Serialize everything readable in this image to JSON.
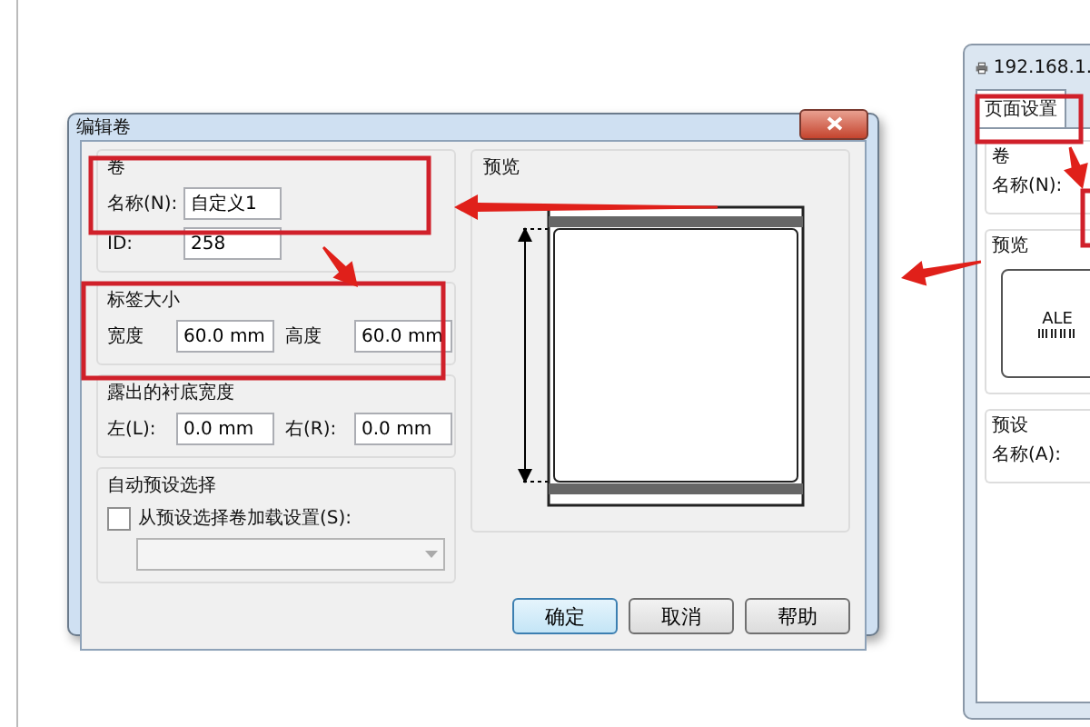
{
  "dialog": {
    "title": "编辑卷",
    "groups": [
      {
        "title": "卷",
        "items": [
          {
            "kind": "fields",
            "fields": [
              {
                "label": "名称(N):",
                "value": "自定义1"
              }
            ]
          },
          {
            "kind": "fields",
            "fields": [
              {
                "label": "ID:",
                "value": "258"
              }
            ]
          }
        ]
      },
      {
        "title": "标签大小",
        "items": [
          {
            "kind": "fields",
            "fields": [
              {
                "label": "宽度",
                "value": "60.0 mm"
              },
              {
                "label": "高度",
                "value": "60.0 mm"
              }
            ]
          }
        ]
      },
      {
        "title": "露出的衬底宽度",
        "items": [
          {
            "kind": "fields",
            "fields": [
              {
                "label": "左(L):",
                "value": "0.0 mm"
              },
              {
                "label": "右(R):",
                "value": "0.0 mm"
              }
            ]
          }
        ]
      },
      {
        "title": "自动预设选择",
        "items": [
          {
            "kind": "checkbox",
            "label": "从预设选择卷加载设置(S):",
            "checked": false
          },
          {
            "kind": "dropdown",
            "disabled": true
          }
        ]
      }
    ],
    "preview": {
      "title": "预览"
    },
    "buttons": [
      {
        "label": "确定",
        "default": true
      },
      {
        "label": "取消",
        "default": false
      },
      {
        "label": "帮助",
        "default": false
      }
    ]
  },
  "second_window": {
    "title": "192.168.1.",
    "tabs": [
      {
        "label": "页面设置",
        "selected": true
      }
    ],
    "groups": [
      {
        "kind": "field",
        "title": "卷",
        "label": "名称(N):"
      },
      {
        "kind": "preview",
        "title": "预览",
        "label_text": "ALE"
      },
      {
        "kind": "field",
        "title": "预设",
        "label": "名称(A):"
      }
    ]
  }
}
